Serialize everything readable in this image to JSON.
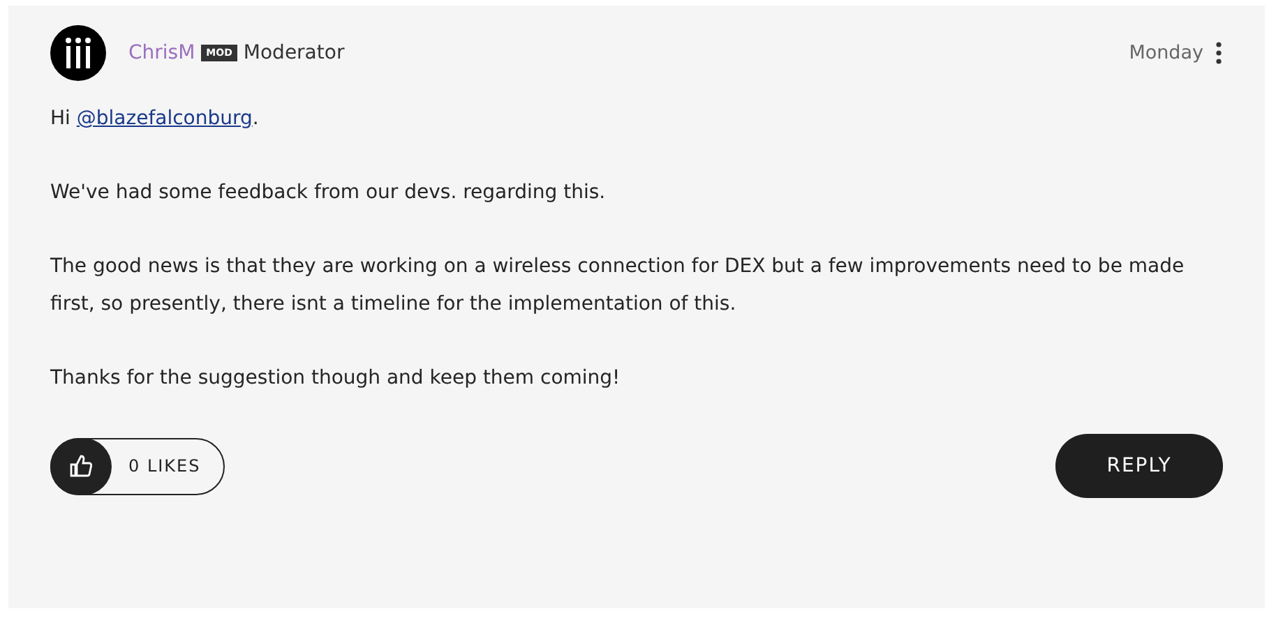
{
  "post": {
    "author": "ChrisM",
    "badge": "MOD",
    "role": "Moderator",
    "time": "Monday",
    "greeting": {
      "before": "Hi ",
      "mention": "@blazefalconburg",
      "after": "."
    },
    "paragraphs": [
      "We've had some feedback from our devs. regarding this.",
      "The good news is that they are working on a wireless connection for DEX but a few improvements need to be made first, so presently, there isnt a timeline for the implementation of this.",
      "Thanks for the suggestion though and keep them coming!"
    ],
    "likes": "0 LIKES",
    "reply": "REPLY"
  }
}
